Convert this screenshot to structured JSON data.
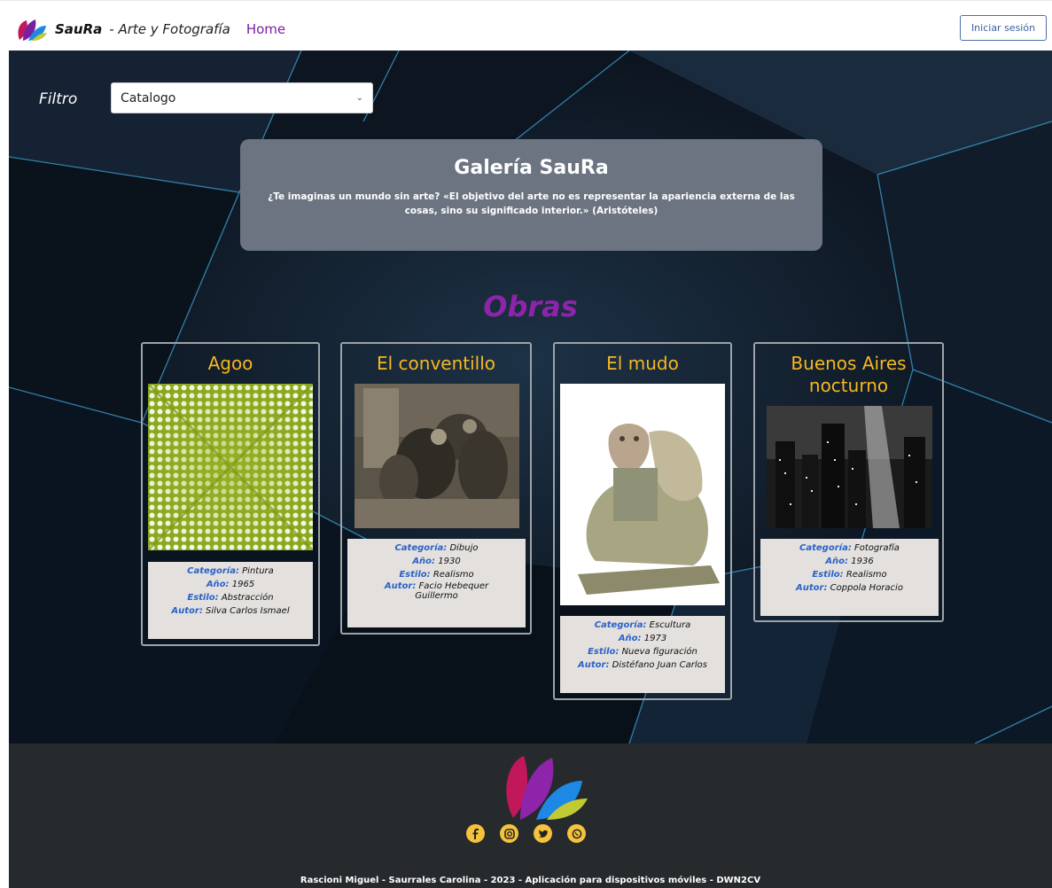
{
  "topbar": {
    "brand_name": "SauRa",
    "brand_sub": "- Arte y Fotografía",
    "home": "Home",
    "login": "Iniciar sesión"
  },
  "filter": {
    "label": "Filtro",
    "selected": "Catalogo"
  },
  "intro": {
    "title": "Galería SauRa",
    "text": "¿Te imaginas un mundo sin arte? «El objetivo del arte no es representar la apariencia externa de las cosas, sino su significado interior.» (Aristóteles)"
  },
  "obras_title": "Obras",
  "labels": {
    "category": "Categoría:",
    "year": "Año:",
    "style": "Estilo:",
    "author": "Autor:"
  },
  "works": [
    {
      "title": "Agoo",
      "category": "Pintura",
      "year": "1965",
      "style": "Abstracción",
      "author": "Silva Carlos Ismael"
    },
    {
      "title": "El conventillo",
      "category": "Dibujo",
      "year": "1930",
      "style": "Realismo",
      "author": "Facio Hebequer Guillermo"
    },
    {
      "title": "El mudo",
      "category": "Escultura",
      "year": "1973",
      "style": "Nueva figuración",
      "author": "Distéfano Juan Carlos"
    },
    {
      "title": "Buenos Aires nocturno",
      "category": "Fotografía",
      "year": "1936",
      "style": "Realismo",
      "author": "Coppola Horacio"
    }
  ],
  "footer": {
    "credits": "Rascioni Miguel - Saurrales Carolina - 2023 - Aplicación para dispositivos móviles - DWN2CV"
  },
  "colors": {
    "accent_purple": "#8e24aa",
    "card_title": "#f5b820",
    "info_key": "#2a62c7",
    "social": "#f5c33b"
  },
  "icons": [
    "facebook-icon",
    "instagram-icon",
    "twitter-icon",
    "whatsapp-icon"
  ]
}
